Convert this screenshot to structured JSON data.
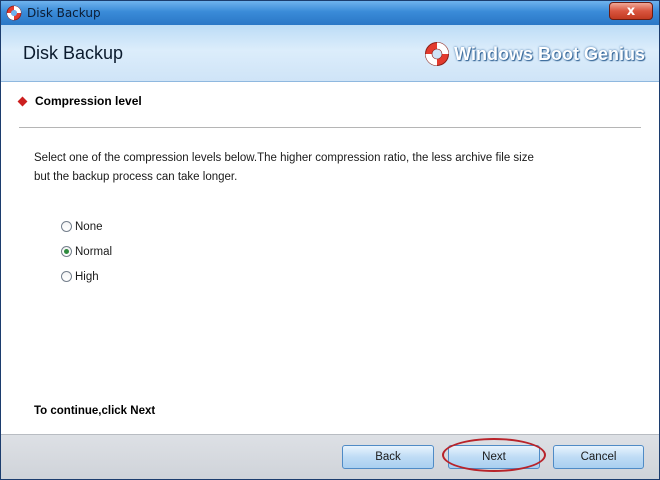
{
  "window": {
    "title": "Disk Backup",
    "close_label": "x"
  },
  "header": {
    "title": "Disk Backup",
    "brand": "Windows Boot Genius"
  },
  "section": {
    "title": "Compression level"
  },
  "description": {
    "line1": "Select one of the compression levels below.The higher compression ratio, the less archive file size",
    "line2": "but the backup process can take longer."
  },
  "compression_options": [
    {
      "label": "None",
      "checked": false
    },
    {
      "label": "Normal",
      "checked": true
    },
    {
      "label": "High",
      "checked": false
    }
  ],
  "continue_text": "To continue,click Next",
  "buttons": {
    "back": "Back",
    "next": "Next",
    "cancel": "Cancel"
  },
  "colors": {
    "accent": "#3a8bd8",
    "highlight": "#b8232a",
    "bullet": "#cc1f1f"
  }
}
